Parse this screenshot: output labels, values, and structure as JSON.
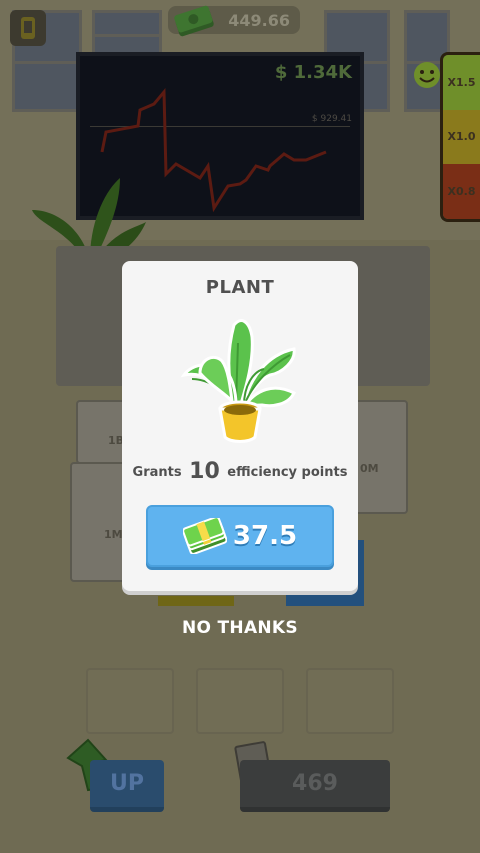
{
  "hud": {
    "cash": "449.66",
    "monitor_value": "$ 1.34K",
    "monitor_sub_value": "$ 929.41",
    "multipliers": [
      "X1.5",
      "X1.0",
      "X0.8"
    ],
    "multiplier_colors": [
      "#6f8f2a",
      "#8a7a1c",
      "#7a2e16"
    ]
  },
  "background_cards": {
    "left_top": "1B",
    "left_bottom": "1M",
    "right_top": "0M"
  },
  "bottom_bar": {
    "up_label": "UP",
    "count_label": "469"
  },
  "modal": {
    "title": "PLANT",
    "grant_prefix": "Grants",
    "grant_value": "10",
    "grant_suffix": "efficiency points",
    "price": "37.5",
    "icon": "cash-stack-icon",
    "item_icon": "potted-plant-icon"
  },
  "no_thanks_label": "NO THANKS",
  "colors": {
    "button_blue": "#5fb3ef",
    "modal_bg": "#f5f5f5",
    "text_dark": "#505050"
  }
}
